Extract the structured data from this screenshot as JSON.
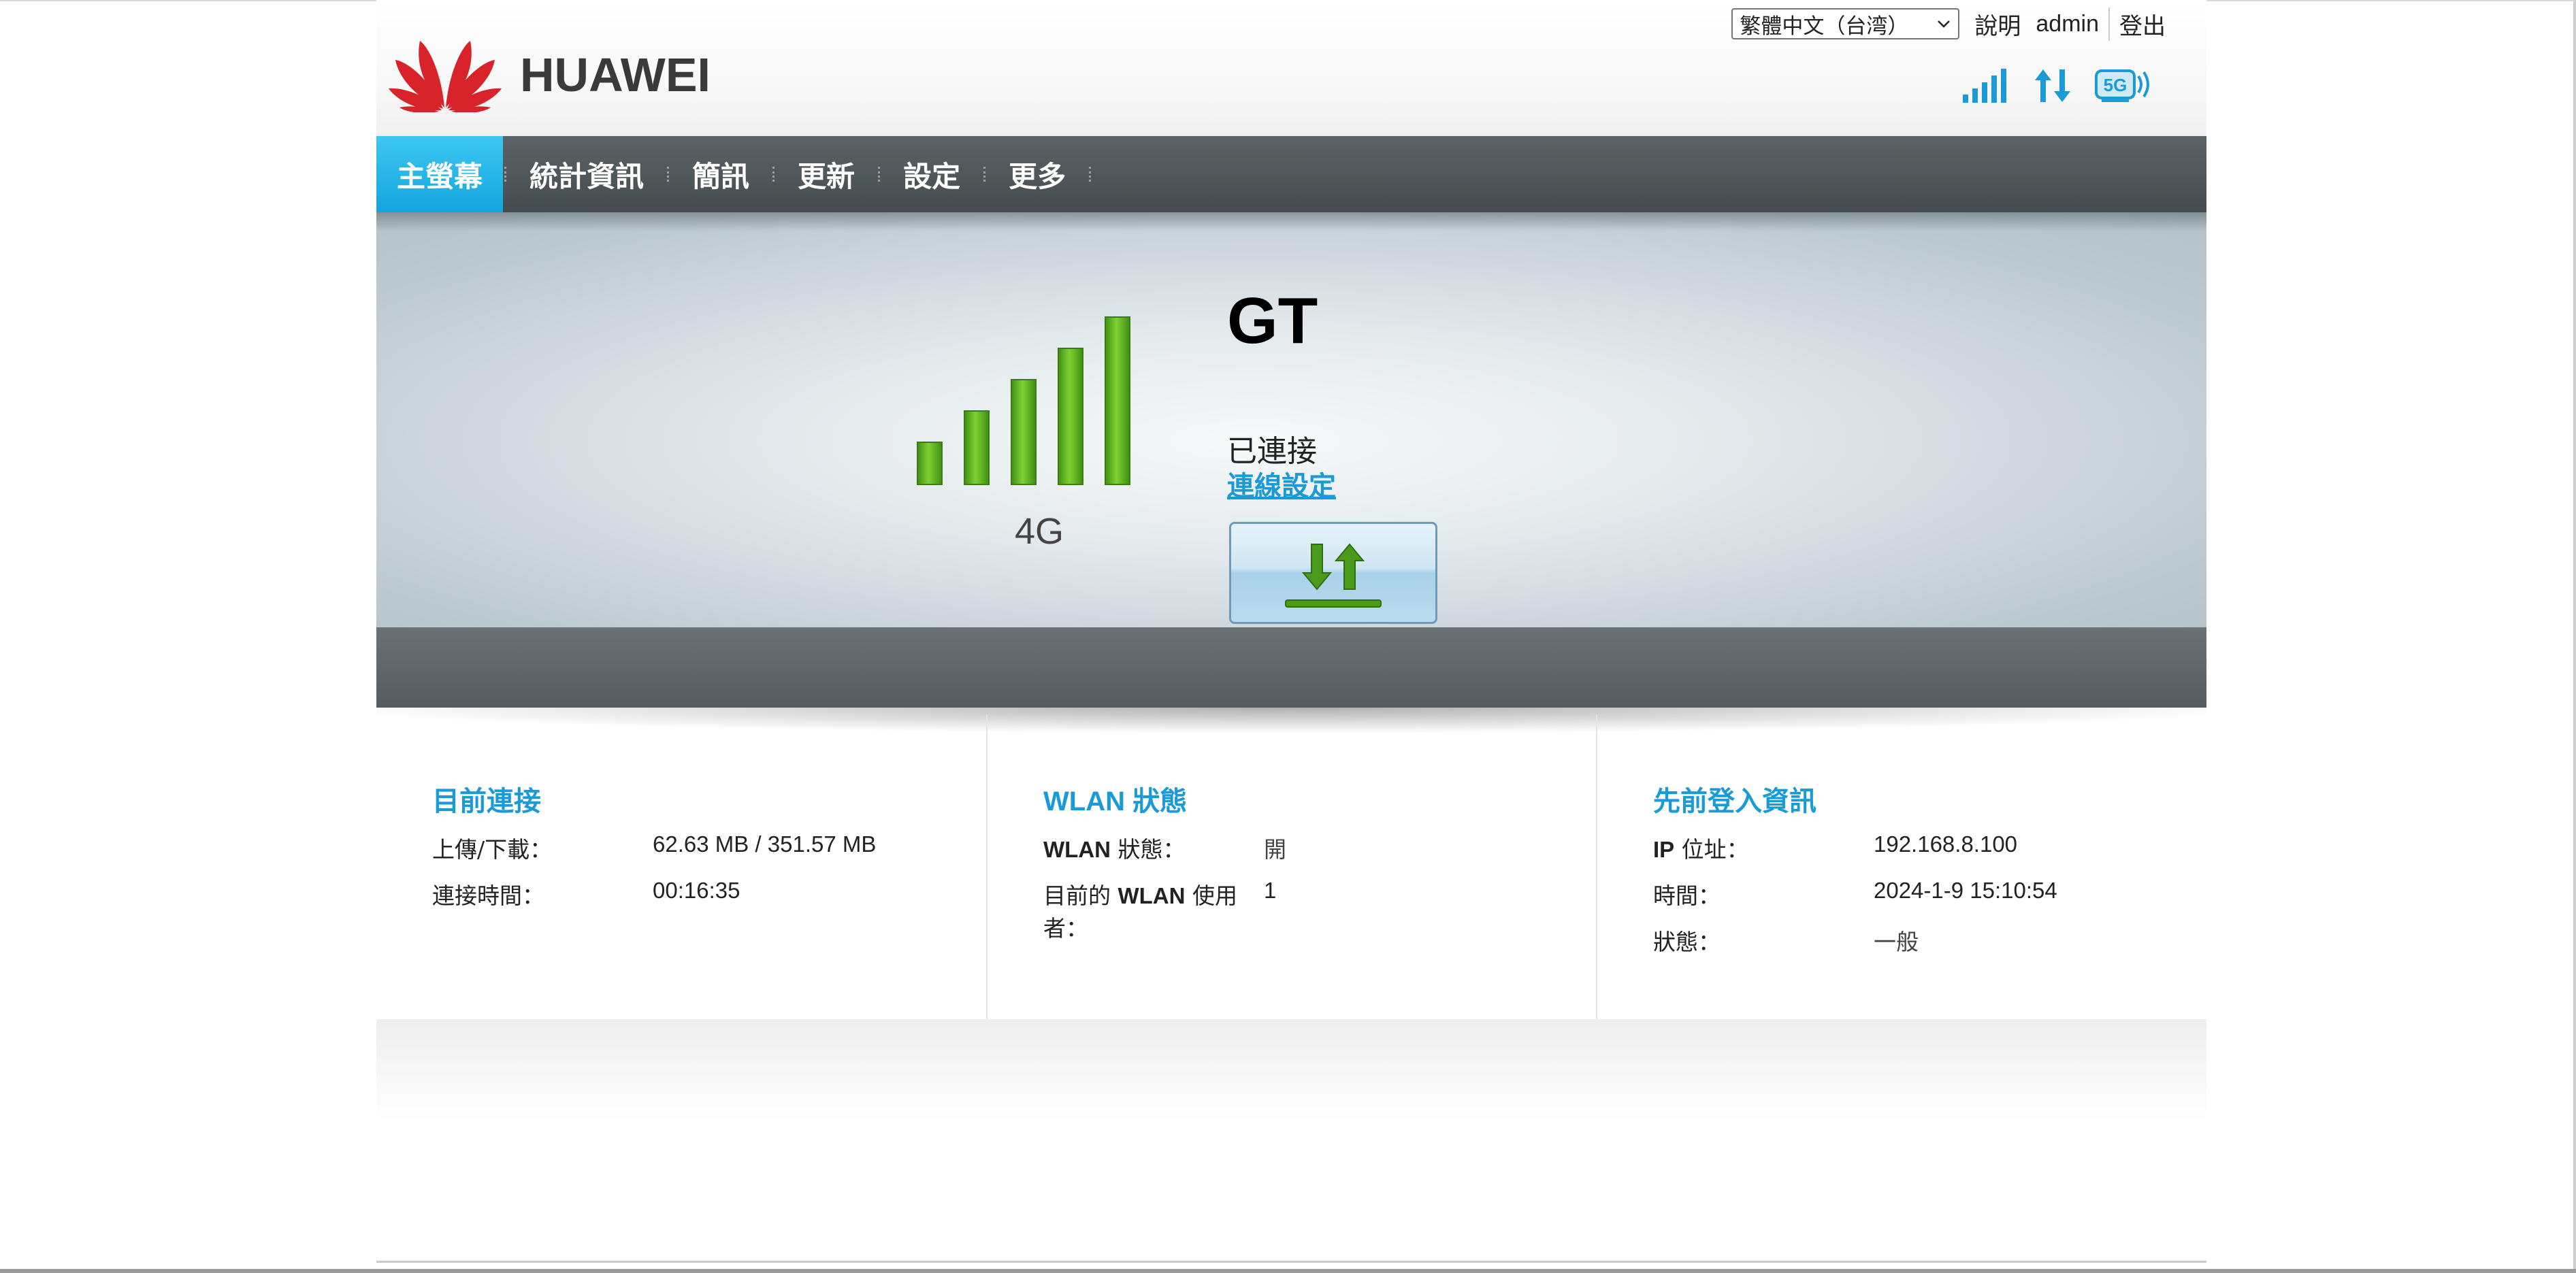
{
  "header": {
    "brand": "HUAWEI",
    "language": "繁體中文（台湾）",
    "help_label": "說明",
    "user_label": "admin",
    "logout_label": "登出"
  },
  "status_icons": [
    "signal-strength-icon",
    "data-transfer-icon",
    "5g-wifi-icon"
  ],
  "colors": {
    "accent": "#1a9ad6",
    "nav_active": "#22b4e8",
    "signal_green": "#5cae24",
    "nav_bg": "#4e5659"
  },
  "nav": {
    "items": [
      {
        "label": "主螢幕",
        "active": true
      },
      {
        "label": "統計資訊",
        "active": false
      },
      {
        "label": "簡訊",
        "active": false
      },
      {
        "label": "更新",
        "active": false
      },
      {
        "label": "設定",
        "active": false
      },
      {
        "label": "更多",
        "active": false
      }
    ]
  },
  "connection": {
    "network_type": "4G",
    "operator": "GT",
    "status": "已連接",
    "settings_link": "連線設定",
    "signal_level": 5,
    "signal_max": 5
  },
  "panels": [
    {
      "title": "目前連接",
      "rows": [
        {
          "label": "上傳/下載：",
          "value": "62.63 MB / 351.57 MB"
        },
        {
          "label": "連接時間：",
          "value": "00:16:35"
        }
      ]
    },
    {
      "title": "WLAN 狀態",
      "rows": [
        {
          "label": "WLAN 狀態：",
          "value": "開"
        },
        {
          "label": "目前的 WLAN 使用者：",
          "value": "1"
        }
      ]
    },
    {
      "title": "先前登入資訊",
      "rows": [
        {
          "label": "IP 位址：",
          "value": "192.168.8.100"
        },
        {
          "label": "時間：",
          "value": "2024-1-9 15:10:54"
        },
        {
          "label": "狀態：",
          "value": "一般"
        }
      ]
    }
  ]
}
